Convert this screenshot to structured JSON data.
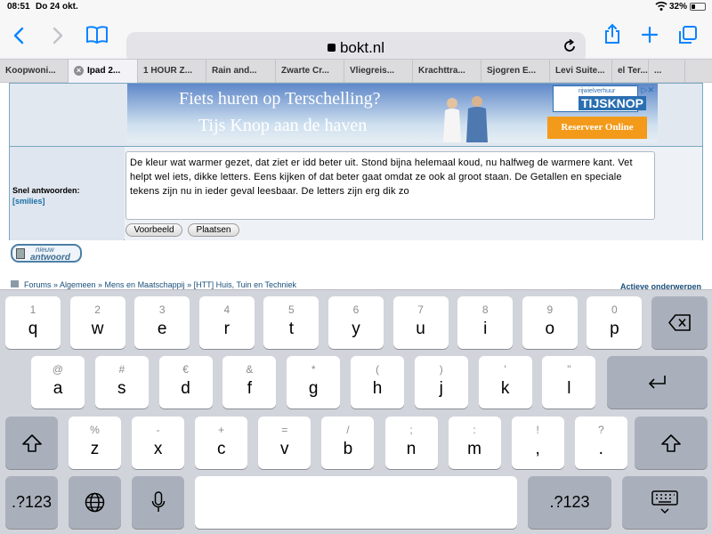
{
  "status": {
    "time": "08:51",
    "date": "Do 24 okt.",
    "battery": "32%",
    "battery_level": 0.32
  },
  "toolbar": {
    "url": "bokt.nl"
  },
  "tabs": [
    {
      "label": "Koopwoni...",
      "active": false,
      "w": 77
    },
    {
      "label": "Ipad 2...",
      "active": true,
      "w": 78
    },
    {
      "label": "1 HOUR Z...",
      "active": false,
      "w": 77
    },
    {
      "label": "Rain and...",
      "active": false,
      "w": 78
    },
    {
      "label": "Zwarte Cr...",
      "active": false,
      "w": 77
    },
    {
      "label": "Vliegreis...",
      "active": false,
      "w": 77
    },
    {
      "label": "Krachttra...",
      "active": false,
      "w": 77
    },
    {
      "label": "Sjogren E...",
      "active": false,
      "w": 77
    },
    {
      "label": "Levi Suite...",
      "active": false,
      "w": 70
    },
    {
      "label": "el Ter...",
      "active": false,
      "w": 41
    },
    {
      "label": "...",
      "active": false,
      "w": 41
    }
  ],
  "ad": {
    "line1": "Fiets huren op Terschelling?",
    "line2": "Tijs Knop aan de haven",
    "logo_small": "rijwielverhuur",
    "logo_big": "TIJSKNOP",
    "cta": "Reserveer Online"
  },
  "reply": {
    "label": "Snel antwoorden:",
    "smilies": "[smilies]",
    "text": "De kleur wat warmer gezet, dat ziet er idd beter uit. Stond bijna helemaal koud, nu halfweg de warmere kant. Vet helpt wel iets, dikke letters. Eens kijken of dat beter gaat omdat ze ook al groot staan. De Getallen en speciale tekens zijn nu in ieder geval leesbaar. De letters zijn erg dik zo",
    "preview_button": "Voorbeeld",
    "post_button": "Plaatsen"
  },
  "new_reply": {
    "small": "nieuw",
    "big": "antwoord"
  },
  "breadcrumb": "Forums » Algemeen » Mens en Maatschappij » [HTT] Huis, Tuin en Techniek",
  "active_topics": "Actieve onderwerpen",
  "keyboard": {
    "row1": [
      {
        "p": "q",
        "s": "1"
      },
      {
        "p": "w",
        "s": "2"
      },
      {
        "p": "e",
        "s": "3"
      },
      {
        "p": "r",
        "s": "4"
      },
      {
        "p": "t",
        "s": "5"
      },
      {
        "p": "y",
        "s": "6"
      },
      {
        "p": "u",
        "s": "7"
      },
      {
        "p": "i",
        "s": "8"
      },
      {
        "p": "o",
        "s": "9"
      },
      {
        "p": "p",
        "s": "0"
      }
    ],
    "row2": [
      {
        "p": "a",
        "s": "@"
      },
      {
        "p": "s",
        "s": "#"
      },
      {
        "p": "d",
        "s": "€"
      },
      {
        "p": "f",
        "s": "&"
      },
      {
        "p": "g",
        "s": "*"
      },
      {
        "p": "h",
        "s": "("
      },
      {
        "p": "j",
        "s": ")"
      },
      {
        "p": "k",
        "s": "'"
      },
      {
        "p": "l",
        "s": "\""
      }
    ],
    "row3": [
      {
        "p": "z",
        "s": "%"
      },
      {
        "p": "x",
        "s": "-"
      },
      {
        "p": "c",
        "s": "+"
      },
      {
        "p": "v",
        "s": "="
      },
      {
        "p": "b",
        "s": "/"
      },
      {
        "p": "n",
        "s": ";"
      },
      {
        "p": "m",
        "s": ":"
      },
      {
        "p": ",",
        "s": "!"
      },
      {
        "p": ".",
        "s": "?"
      }
    ],
    "numbers_label": ".?123"
  }
}
